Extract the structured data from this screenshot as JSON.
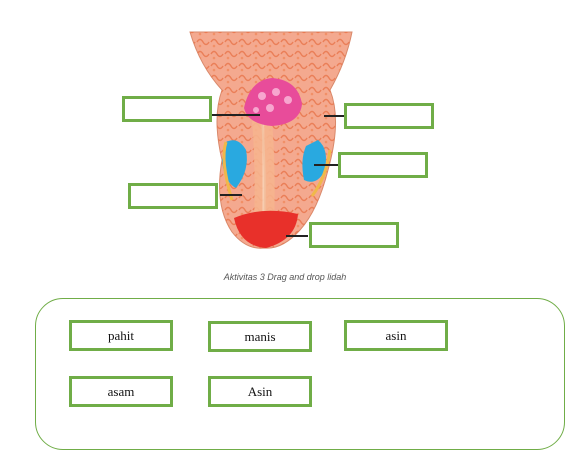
{
  "caption": "Aktivitas  3 Drag and drop lidah",
  "drop_targets": [
    "",
    "",
    "",
    "",
    ""
  ],
  "answer_chips": [
    "pahit",
    "manis",
    "asin",
    "asam",
    "Asin"
  ],
  "colors": {
    "accent_green": "#70ad47",
    "bitter_zone": "#e84c9a",
    "sour_zone": "#29a9e0",
    "sweet_zone": "#e8302a",
    "tongue_base": "#f4a98f"
  }
}
